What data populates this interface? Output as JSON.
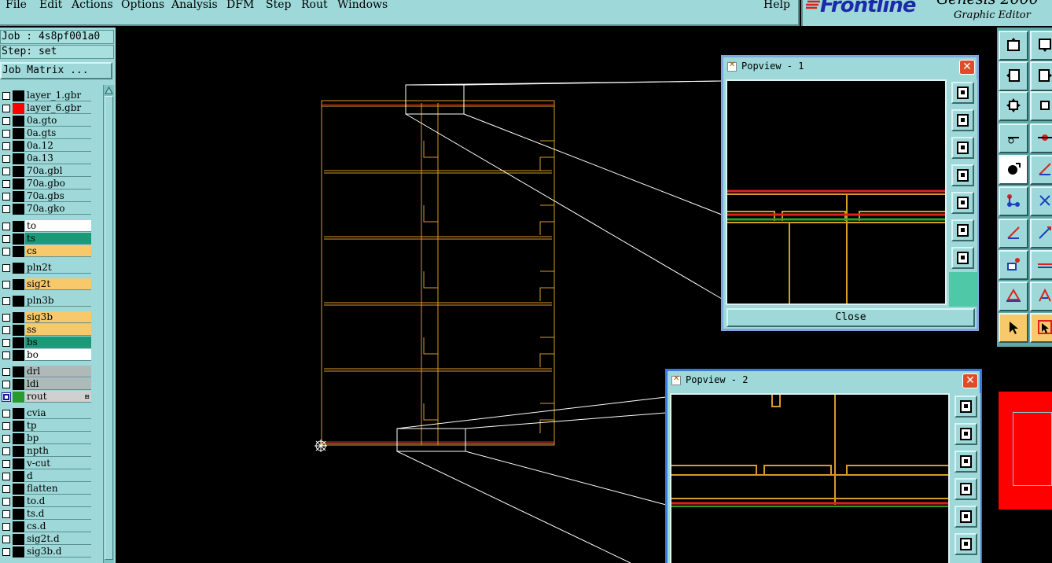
{
  "menubar": {
    "items": [
      {
        "label": "File",
        "underline": "F"
      },
      {
        "label": "Edit",
        "underline": "E"
      },
      {
        "label": "Actions",
        "underline": "A"
      },
      {
        "label": "Options",
        "underline": "O"
      },
      {
        "label": "Analysis",
        "underline": "n"
      },
      {
        "label": "DFM",
        "underline": "D"
      },
      {
        "label": "Step",
        "underline": "S"
      },
      {
        "label": "Rout",
        "underline": "R"
      },
      {
        "label": "Windows",
        "underline": "W"
      }
    ],
    "help": "Help"
  },
  "logo": {
    "brand": "Frontline",
    "product": "Genesis 2000",
    "subtitle": "Graphic Editor"
  },
  "leftpanel": {
    "job": "Job : 4s8pf001a0",
    "step": "Step: set",
    "job_matrix": "Job Matrix ..."
  },
  "layers": [
    {
      "name": "layer_1.gbr",
      "swatch": "#000000",
      "bg": "#9ed8d8",
      "checked": false
    },
    {
      "name": "layer_6.gbr",
      "swatch": "#ff0000",
      "bg": "#9ed8d8",
      "checked": false
    },
    {
      "name": "0a.gto",
      "swatch": "#000000",
      "bg": "#9ed8d8",
      "checked": false
    },
    {
      "name": "0a.gts",
      "swatch": "#000000",
      "bg": "#9ed8d8",
      "checked": false
    },
    {
      "name": "0a.12",
      "swatch": "#000000",
      "bg": "#9ed8d8",
      "checked": false
    },
    {
      "name": "0a.13",
      "swatch": "#000000",
      "bg": "#9ed8d8",
      "checked": false
    },
    {
      "name": "70a.gbl",
      "swatch": "#000000",
      "bg": "#9ed8d8",
      "checked": false
    },
    {
      "name": "70a.gbo",
      "swatch": "#000000",
      "bg": "#9ed8d8",
      "checked": false
    },
    {
      "name": "70a.gbs",
      "swatch": "#000000",
      "bg": "#9ed8d8",
      "checked": false
    },
    {
      "name": "70a.gko",
      "swatch": "#000000",
      "bg": "#9ed8d8",
      "checked": false
    },
    {
      "name": "to",
      "swatch": "#000000",
      "bg": "#ffffff",
      "checked": false
    },
    {
      "name": "ts",
      "swatch": "#000000",
      "bg": "#1a9a78",
      "checked": false
    },
    {
      "name": "cs",
      "swatch": "#000000",
      "bg": "#f7c96a",
      "checked": false
    },
    {
      "name": "pln2t",
      "swatch": "#000000",
      "bg": "#9ed8d8",
      "checked": false
    },
    {
      "name": "sig2t",
      "swatch": "#000000",
      "bg": "#f7c96a",
      "checked": false
    },
    {
      "name": "pln3b",
      "swatch": "#000000",
      "bg": "#9ed8d8",
      "checked": false
    },
    {
      "name": "sig3b",
      "swatch": "#000000",
      "bg": "#f7c96a",
      "checked": false
    },
    {
      "name": "ss",
      "swatch": "#000000",
      "bg": "#f7c96a",
      "checked": false
    },
    {
      "name": "bs",
      "swatch": "#000000",
      "bg": "#1a9a78",
      "checked": false
    },
    {
      "name": "bo",
      "swatch": "#000000",
      "bg": "#ffffff",
      "checked": false
    },
    {
      "name": "drl",
      "swatch": "#000000",
      "bg": "#b0b8b8",
      "checked": false
    },
    {
      "name": "ldi",
      "swatch": "#000000",
      "bg": "#b0b8b8",
      "checked": false
    },
    {
      "name": "rout",
      "swatch": "#2a9a2a",
      "bg": "#d0d0d0",
      "checked": true,
      "expand": "⊞"
    },
    {
      "name": "cvia",
      "swatch": "#000000",
      "bg": "#9ed8d8",
      "checked": false
    },
    {
      "name": "tp",
      "swatch": "#000000",
      "bg": "#9ed8d8",
      "checked": false
    },
    {
      "name": "bp",
      "swatch": "#000000",
      "bg": "#9ed8d8",
      "checked": false
    },
    {
      "name": "npth",
      "swatch": "#000000",
      "bg": "#9ed8d8",
      "checked": false
    },
    {
      "name": "v-cut",
      "swatch": "#000000",
      "bg": "#9ed8d8",
      "checked": false
    },
    {
      "name": "d",
      "swatch": "#000000",
      "bg": "#9ed8d8",
      "checked": false
    },
    {
      "name": "flatten",
      "swatch": "#000000",
      "bg": "#9ed8d8",
      "checked": false
    },
    {
      "name": "to.d",
      "swatch": "#000000",
      "bg": "#9ed8d8",
      "checked": false
    },
    {
      "name": "ts.d",
      "swatch": "#000000",
      "bg": "#9ed8d8",
      "checked": false
    },
    {
      "name": "cs.d",
      "swatch": "#000000",
      "bg": "#9ed8d8",
      "checked": false
    },
    {
      "name": "sig2t.d",
      "swatch": "#000000",
      "bg": "#9ed8d8",
      "checked": false
    },
    {
      "name": "sig3b.d",
      "swatch": "#000000",
      "bg": "#9ed8d8",
      "checked": false
    }
  ],
  "popview1": {
    "title": "Popview - 1",
    "close_label": "Close"
  },
  "popview2": {
    "title": "Popview - 2"
  },
  "colors": {
    "trace": "#d89a2a",
    "red_line": "#e02020",
    "green_line": "#2aa02a",
    "zoom_lines": "#ffffff"
  },
  "icons": {
    "popview_tools": [
      "zoom-fit-icon",
      "pan-up-icon",
      "pan-down-icon",
      "pan-left-icon",
      "pan-right-icon",
      "zoom-in-icon",
      "zoom-out-icon"
    ],
    "right_tools": [
      "pan-up-icon",
      "pan-down-icon",
      "pan-left-icon",
      "pan-right-icon",
      "zoom-fit-icon",
      "zoom-home-icon",
      "measure-icon",
      "snap-icon",
      "pad-icon",
      "rotate-icon",
      "connect-icon",
      "cross-icon",
      "line-icon",
      "arrow-line-icon",
      "pad-shape-icon",
      "line-shape-icon",
      "triangle-icon",
      "arc-icon",
      "select-pointer-icon",
      "select-region-icon"
    ]
  }
}
